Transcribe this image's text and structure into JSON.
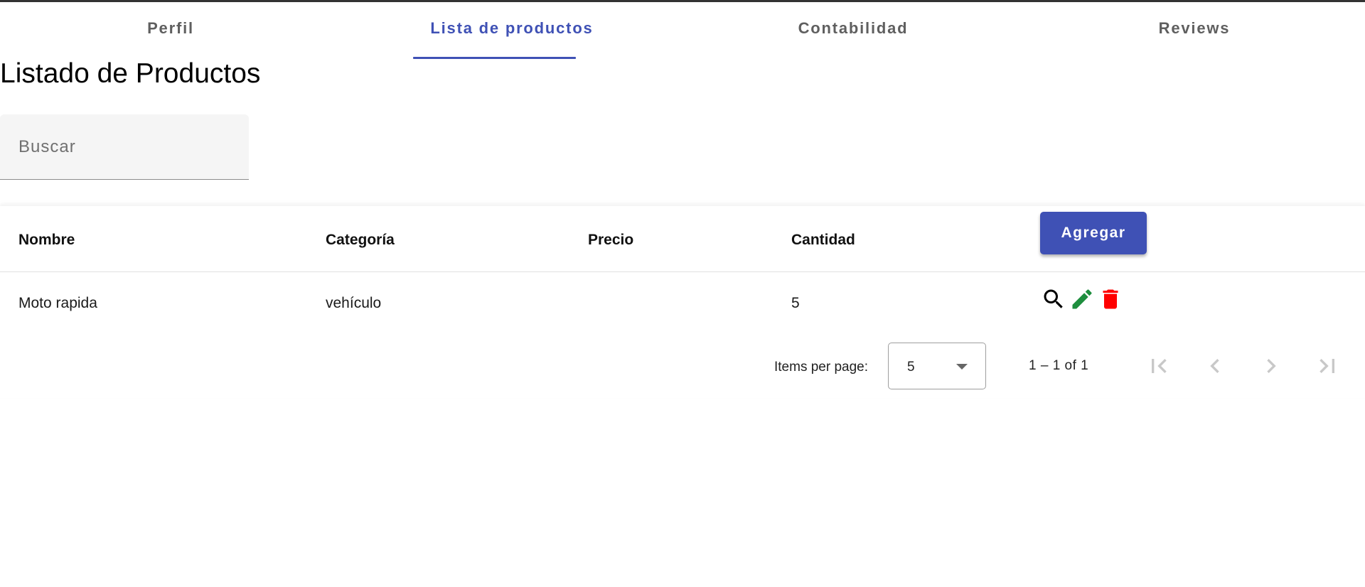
{
  "tabs": [
    {
      "label": "Perfil",
      "active": false
    },
    {
      "label": "Lista de productos",
      "active": true
    },
    {
      "label": "Contabilidad",
      "active": false
    },
    {
      "label": "Reviews",
      "active": false
    }
  ],
  "page_title": "Listado de Productos",
  "search": {
    "placeholder": "Buscar",
    "value": ""
  },
  "table": {
    "columns": [
      "Nombre",
      "Categoría",
      "Precio",
      "Cantidad"
    ],
    "add_button_label": "Agregar",
    "rows": [
      {
        "nombre": "Moto rapida",
        "categoria": "vehículo",
        "precio": "",
        "cantidad": "5",
        "actions": [
          "search-icon",
          "edit-icon",
          "delete-icon"
        ]
      }
    ]
  },
  "paginator": {
    "items_per_page_label": "Items per page:",
    "page_size": "5",
    "range_label": "1 – 1 of 1",
    "buttons": [
      "first-page-icon",
      "previous-page-icon",
      "next-page-icon",
      "last-page-icon"
    ]
  },
  "colors": {
    "primary": "#3f51b5",
    "edit_icon": "#1e8e3e",
    "delete_icon": "#ff0000",
    "tab_inactive": "#5f5f5f",
    "disabled_icon": "#c8c8c8"
  }
}
